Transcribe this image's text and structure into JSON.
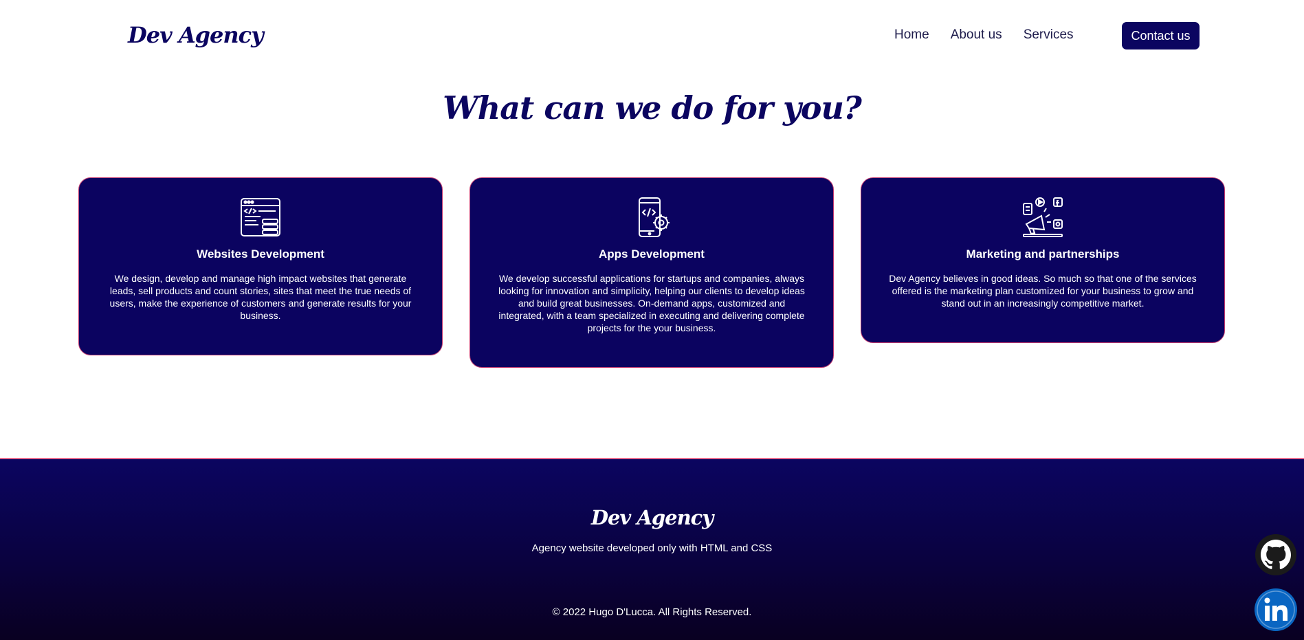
{
  "header": {
    "logo": "Dev Agency",
    "nav": [
      "Home",
      "About us",
      "Services"
    ],
    "contact_label": "Contact us"
  },
  "main": {
    "title": "What can we do for you?",
    "cards": [
      {
        "icon": "website-code-icon",
        "title": "Websites Development",
        "text": "We design, develop and manage high impact websites that generate leads, sell products and count stories, sites that meet the true needs of users, make the experience of customers and generate results for your business."
      },
      {
        "icon": "mobile-app-gear-icon",
        "title": "Apps Development",
        "text": "We develop successful applications for startups and companies, always looking for innovation and simplicity, helping our clients to develop ideas and build great businesses. On-demand apps, customized and integrated, with a team specialized in executing and delivering complete projects for the your business."
      },
      {
        "icon": "marketing-megaphone-icon",
        "title": "Marketing and partnerships",
        "text": "Dev Agency believes in good ideas. So much so that one of the services offered is the marketing plan customized for your business to grow and stand out in an increasingly competitive market."
      }
    ]
  },
  "footer": {
    "logo": "Dev Agency",
    "tagline": "Agency website developed only with HTML and CSS",
    "copyright": "© 2022 Hugo D'Lucca. All Rights Reserved."
  },
  "social": {
    "github_icon": "github-icon",
    "linkedin_icon": "linkedin-icon"
  },
  "colors": {
    "primary": "#0b0560",
    "card_border": "#c33a6f",
    "footer_border": "#e86a8c",
    "linkedin": "#0a66c2"
  }
}
